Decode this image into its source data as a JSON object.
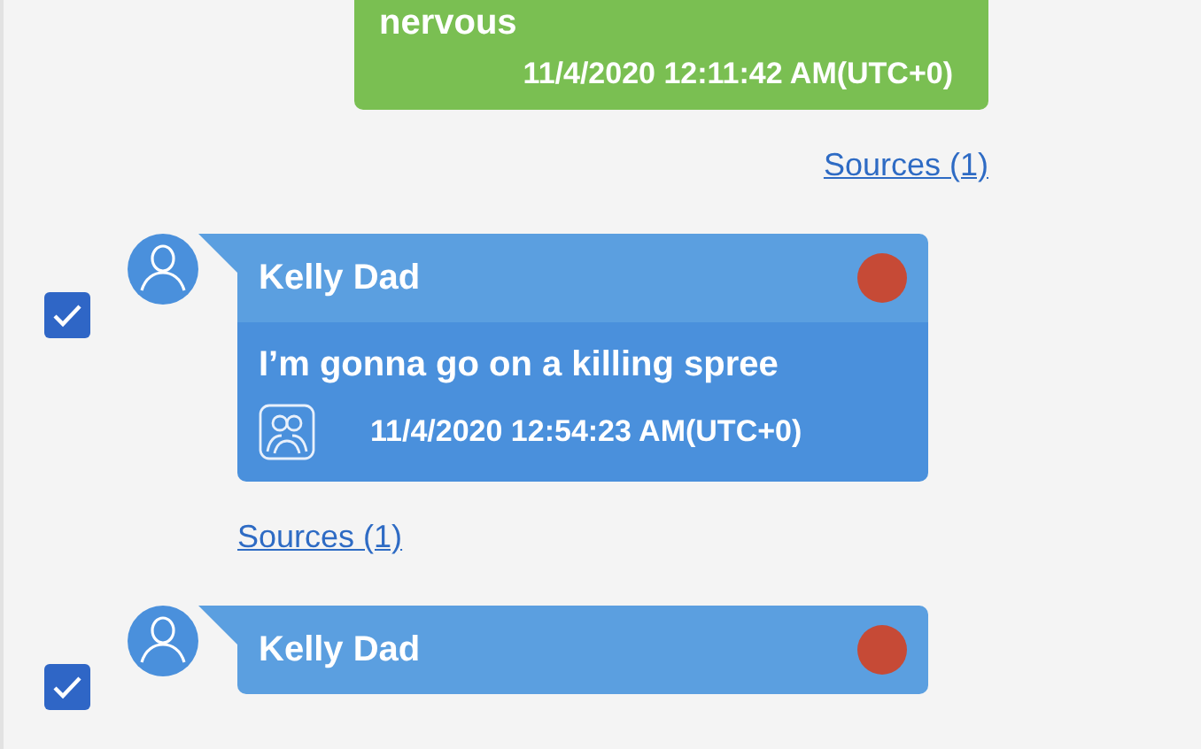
{
  "messages": [
    {
      "kind": "outgoing",
      "text": "nervous",
      "timestamp": "11/4/2020 12:11:42 AM(UTC+0)",
      "sources": "Sources (1)"
    },
    {
      "kind": "incoming",
      "checked": true,
      "sender": "Kelly Dad",
      "color": "#c64a36",
      "text": "I’m gonna go on a killing spree",
      "timestamp": "11/4/2020 12:54:23 AM(UTC+0)",
      "sources": "Sources (1)"
    },
    {
      "kind": "incoming",
      "checked": true,
      "sender": "Kelly Dad",
      "color": "#c64a36"
    }
  ]
}
